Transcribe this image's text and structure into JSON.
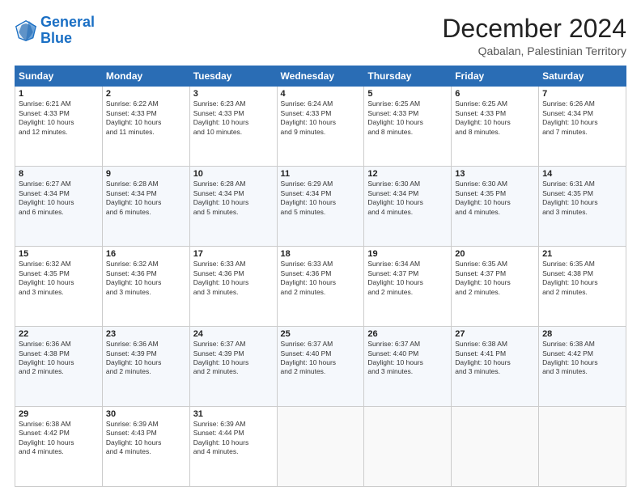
{
  "header": {
    "logo_line1": "General",
    "logo_line2": "Blue",
    "title": "December 2024",
    "subtitle": "Qabalan, Palestinian Territory"
  },
  "days_of_week": [
    "Sunday",
    "Monday",
    "Tuesday",
    "Wednesday",
    "Thursday",
    "Friday",
    "Saturday"
  ],
  "weeks": [
    [
      {
        "day": "1",
        "info": "Sunrise: 6:21 AM\nSunset: 4:33 PM\nDaylight: 10 hours\nand 12 minutes."
      },
      {
        "day": "2",
        "info": "Sunrise: 6:22 AM\nSunset: 4:33 PM\nDaylight: 10 hours\nand 11 minutes."
      },
      {
        "day": "3",
        "info": "Sunrise: 6:23 AM\nSunset: 4:33 PM\nDaylight: 10 hours\nand 10 minutes."
      },
      {
        "day": "4",
        "info": "Sunrise: 6:24 AM\nSunset: 4:33 PM\nDaylight: 10 hours\nand 9 minutes."
      },
      {
        "day": "5",
        "info": "Sunrise: 6:25 AM\nSunset: 4:33 PM\nDaylight: 10 hours\nand 8 minutes."
      },
      {
        "day": "6",
        "info": "Sunrise: 6:25 AM\nSunset: 4:33 PM\nDaylight: 10 hours\nand 8 minutes."
      },
      {
        "day": "7",
        "info": "Sunrise: 6:26 AM\nSunset: 4:34 PM\nDaylight: 10 hours\nand 7 minutes."
      }
    ],
    [
      {
        "day": "8",
        "info": "Sunrise: 6:27 AM\nSunset: 4:34 PM\nDaylight: 10 hours\nand 6 minutes."
      },
      {
        "day": "9",
        "info": "Sunrise: 6:28 AM\nSunset: 4:34 PM\nDaylight: 10 hours\nand 6 minutes."
      },
      {
        "day": "10",
        "info": "Sunrise: 6:28 AM\nSunset: 4:34 PM\nDaylight: 10 hours\nand 5 minutes."
      },
      {
        "day": "11",
        "info": "Sunrise: 6:29 AM\nSunset: 4:34 PM\nDaylight: 10 hours\nand 5 minutes."
      },
      {
        "day": "12",
        "info": "Sunrise: 6:30 AM\nSunset: 4:34 PM\nDaylight: 10 hours\nand 4 minutes."
      },
      {
        "day": "13",
        "info": "Sunrise: 6:30 AM\nSunset: 4:35 PM\nDaylight: 10 hours\nand 4 minutes."
      },
      {
        "day": "14",
        "info": "Sunrise: 6:31 AM\nSunset: 4:35 PM\nDaylight: 10 hours\nand 3 minutes."
      }
    ],
    [
      {
        "day": "15",
        "info": "Sunrise: 6:32 AM\nSunset: 4:35 PM\nDaylight: 10 hours\nand 3 minutes."
      },
      {
        "day": "16",
        "info": "Sunrise: 6:32 AM\nSunset: 4:36 PM\nDaylight: 10 hours\nand 3 minutes."
      },
      {
        "day": "17",
        "info": "Sunrise: 6:33 AM\nSunset: 4:36 PM\nDaylight: 10 hours\nand 3 minutes."
      },
      {
        "day": "18",
        "info": "Sunrise: 6:33 AM\nSunset: 4:36 PM\nDaylight: 10 hours\nand 2 minutes."
      },
      {
        "day": "19",
        "info": "Sunrise: 6:34 AM\nSunset: 4:37 PM\nDaylight: 10 hours\nand 2 minutes."
      },
      {
        "day": "20",
        "info": "Sunrise: 6:35 AM\nSunset: 4:37 PM\nDaylight: 10 hours\nand 2 minutes."
      },
      {
        "day": "21",
        "info": "Sunrise: 6:35 AM\nSunset: 4:38 PM\nDaylight: 10 hours\nand 2 minutes."
      }
    ],
    [
      {
        "day": "22",
        "info": "Sunrise: 6:36 AM\nSunset: 4:38 PM\nDaylight: 10 hours\nand 2 minutes."
      },
      {
        "day": "23",
        "info": "Sunrise: 6:36 AM\nSunset: 4:39 PM\nDaylight: 10 hours\nand 2 minutes."
      },
      {
        "day": "24",
        "info": "Sunrise: 6:37 AM\nSunset: 4:39 PM\nDaylight: 10 hours\nand 2 minutes."
      },
      {
        "day": "25",
        "info": "Sunrise: 6:37 AM\nSunset: 4:40 PM\nDaylight: 10 hours\nand 2 minutes."
      },
      {
        "day": "26",
        "info": "Sunrise: 6:37 AM\nSunset: 4:40 PM\nDaylight: 10 hours\nand 3 minutes."
      },
      {
        "day": "27",
        "info": "Sunrise: 6:38 AM\nSunset: 4:41 PM\nDaylight: 10 hours\nand 3 minutes."
      },
      {
        "day": "28",
        "info": "Sunrise: 6:38 AM\nSunset: 4:42 PM\nDaylight: 10 hours\nand 3 minutes."
      }
    ],
    [
      {
        "day": "29",
        "info": "Sunrise: 6:38 AM\nSunset: 4:42 PM\nDaylight: 10 hours\nand 4 minutes."
      },
      {
        "day": "30",
        "info": "Sunrise: 6:39 AM\nSunset: 4:43 PM\nDaylight: 10 hours\nand 4 minutes."
      },
      {
        "day": "31",
        "info": "Sunrise: 6:39 AM\nSunset: 4:44 PM\nDaylight: 10 hours\nand 4 minutes."
      },
      null,
      null,
      null,
      null
    ]
  ]
}
